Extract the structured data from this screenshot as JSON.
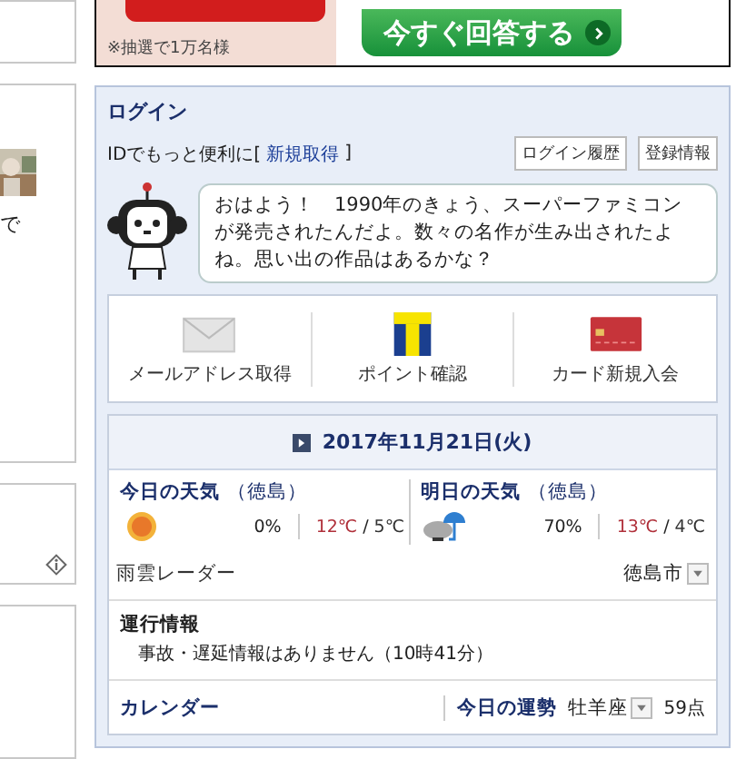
{
  "left_column": {
    "snippet": "で"
  },
  "banner": {
    "note": "※抽選で1万名様",
    "button": "今すぐ回答する"
  },
  "login": {
    "title": "ログイン",
    "prompt": "IDでもっと便利に[",
    "link": "新規取得",
    "prompt_end": "]",
    "buttons": [
      "ログイン履歴",
      "登録情報"
    ],
    "message": "おはよう！　1990年のきょう、スーパーファミコンが発売されたんだよ。数々の名作が生み出されたよね。思い出の作品はあるかな？"
  },
  "services": [
    {
      "kind": "mail",
      "label": "メールアドレス取得"
    },
    {
      "kind": "tpoint",
      "label": "ポイント確認"
    },
    {
      "kind": "card",
      "label": "カード新規入会"
    }
  ],
  "date": "2017年11月21日(火)",
  "weather": [
    {
      "title": "今日の天気",
      "place": "（徳島）",
      "kind": "sun",
      "rain": "0%",
      "high": "12℃",
      "separator": "/",
      "low": "5℃"
    },
    {
      "title": "明日の天気",
      "place": "（徳島）",
      "kind": "cloud-rain",
      "rain": "70%",
      "high": "13℃",
      "separator": "/",
      "low": "4℃"
    }
  ],
  "radar": {
    "label": "雨雲レーダー",
    "city": "徳島市"
  },
  "traffic": {
    "title": "運行情報",
    "text": "事故・遅延情報はありません（10時41分）"
  },
  "footer": {
    "calendar": "カレンダー",
    "fortune": "今日の運勢",
    "sign": "牡羊座",
    "score": "59点"
  }
}
